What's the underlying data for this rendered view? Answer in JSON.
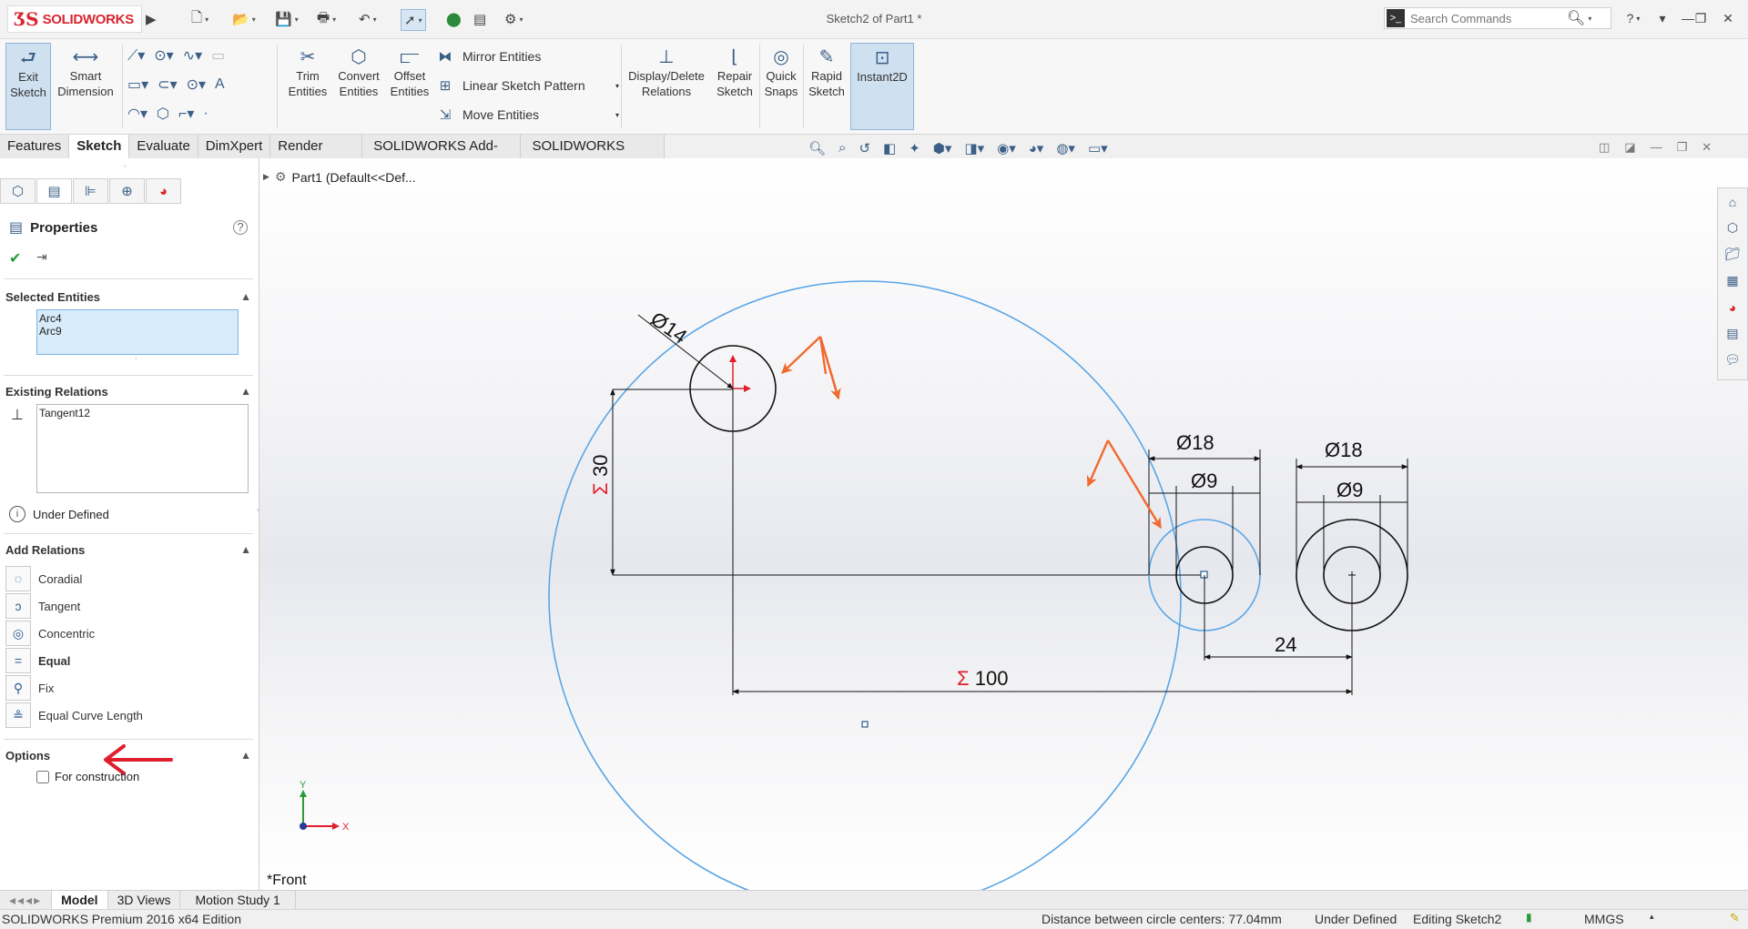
{
  "app": {
    "logo_text": "SOLIDWORKS",
    "doc_title": "Sketch2 of Part1 *",
    "search_placeholder": "Search Commands",
    "help_label": "?"
  },
  "toolbar": {
    "exit_sketch": "Exit Sketch",
    "smart_dimension": "Smart Dimension",
    "trim_entities": "Trim Entities",
    "convert_entities": "Convert Entities",
    "offset_entities": "Offset Entities",
    "mirror_entities": "Mirror Entities",
    "linear_sketch_pattern": "Linear Sketch Pattern",
    "move_entities": "Move Entities",
    "display_delete_relations": "Display/Delete Relations",
    "repair_sketch": "Repair Sketch",
    "quick_snaps": "Quick Snaps",
    "rapid_sketch": "Rapid Sketch",
    "instant2d": "Instant2D"
  },
  "tabs": [
    "Features",
    "Sketch",
    "Evaluate",
    "DimXpert",
    "Render Tools",
    "SOLIDWORKS Add-Ins",
    "SOLIDWORKS MBD"
  ],
  "active_tab": "Sketch",
  "tree": {
    "part_label": "Part1  (Default<<Def..."
  },
  "properties": {
    "title": "Properties",
    "selected_entities_header": "Selected Entities",
    "selected_entities": [
      "Arc4",
      "Arc9"
    ],
    "existing_relations_header": "Existing Relations",
    "existing_relations": [
      "Tangent12"
    ],
    "status": "Under Defined",
    "add_relations_header": "Add Relations",
    "add_relations": [
      "Coradial",
      "Tangent",
      "Concentric",
      "Equal",
      "Fix",
      "Equal Curve Length"
    ],
    "options_header": "Options",
    "for_construction": "For construction"
  },
  "sketch": {
    "dims": {
      "d14": "14",
      "d30": "30",
      "d18a": "18",
      "d9a": "9",
      "d18b": "18",
      "d9b": "9",
      "d24": "24",
      "d100": "100"
    },
    "view_label": "*Front",
    "axis_x": "X",
    "axis_y": "Y"
  },
  "bottom_tabs": [
    "Model",
    "3D Views",
    "Motion Study 1"
  ],
  "status_bar": {
    "edition": "SOLIDWORKS Premium 2016 x64 Edition",
    "distance": "Distance between circle centers: 77.04mm",
    "defined": "Under Defined",
    "editing": "Editing Sketch2",
    "units": "MMGS"
  },
  "colors": {
    "accent_blue": "#3b5f87",
    "sketch_blue": "#5aa6e6",
    "annotation_orange": "#f06a30",
    "annotation_red": "#e01e2e",
    "brand_red": "#d8262e"
  }
}
